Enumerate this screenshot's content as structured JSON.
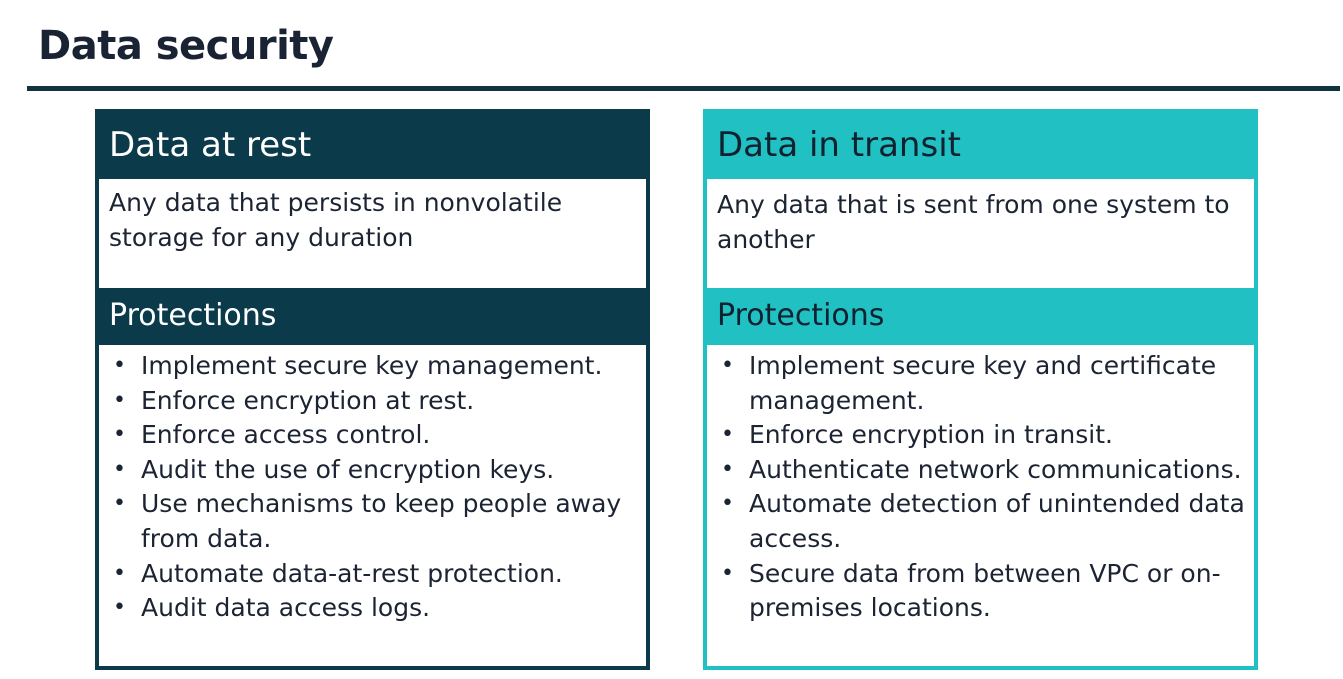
{
  "slide": {
    "title": "Data security"
  },
  "rest": {
    "heading": "Data at rest",
    "description": "Any data that persists in nonvolatile storage for any duration",
    "protections_label": "Protections",
    "protections": [
      "Implement secure key management.",
      "Enforce encryption at rest.",
      "Enforce access control.",
      "Audit the use of encryption keys.",
      "Use mechanisms to keep people away from data.",
      "Automate data-at-rest protection.",
      "Audit data access logs."
    ]
  },
  "transit": {
    "heading": "Data in transit",
    "description": "Any data that is sent from one system to another",
    "protections_label": "Protections",
    "protections": [
      "Implement secure key and certificate management.",
      "Enforce encryption in transit.",
      "Authenticate network communications.",
      "Automate detection of unintended data access.",
      "Secure data from between VPC or on-premises locations."
    ]
  },
  "colors": {
    "rest_accent": "#0b3a4a",
    "transit_accent": "#21c0c2",
    "rule": "#10333f"
  },
  "bullet_glyph": "•"
}
